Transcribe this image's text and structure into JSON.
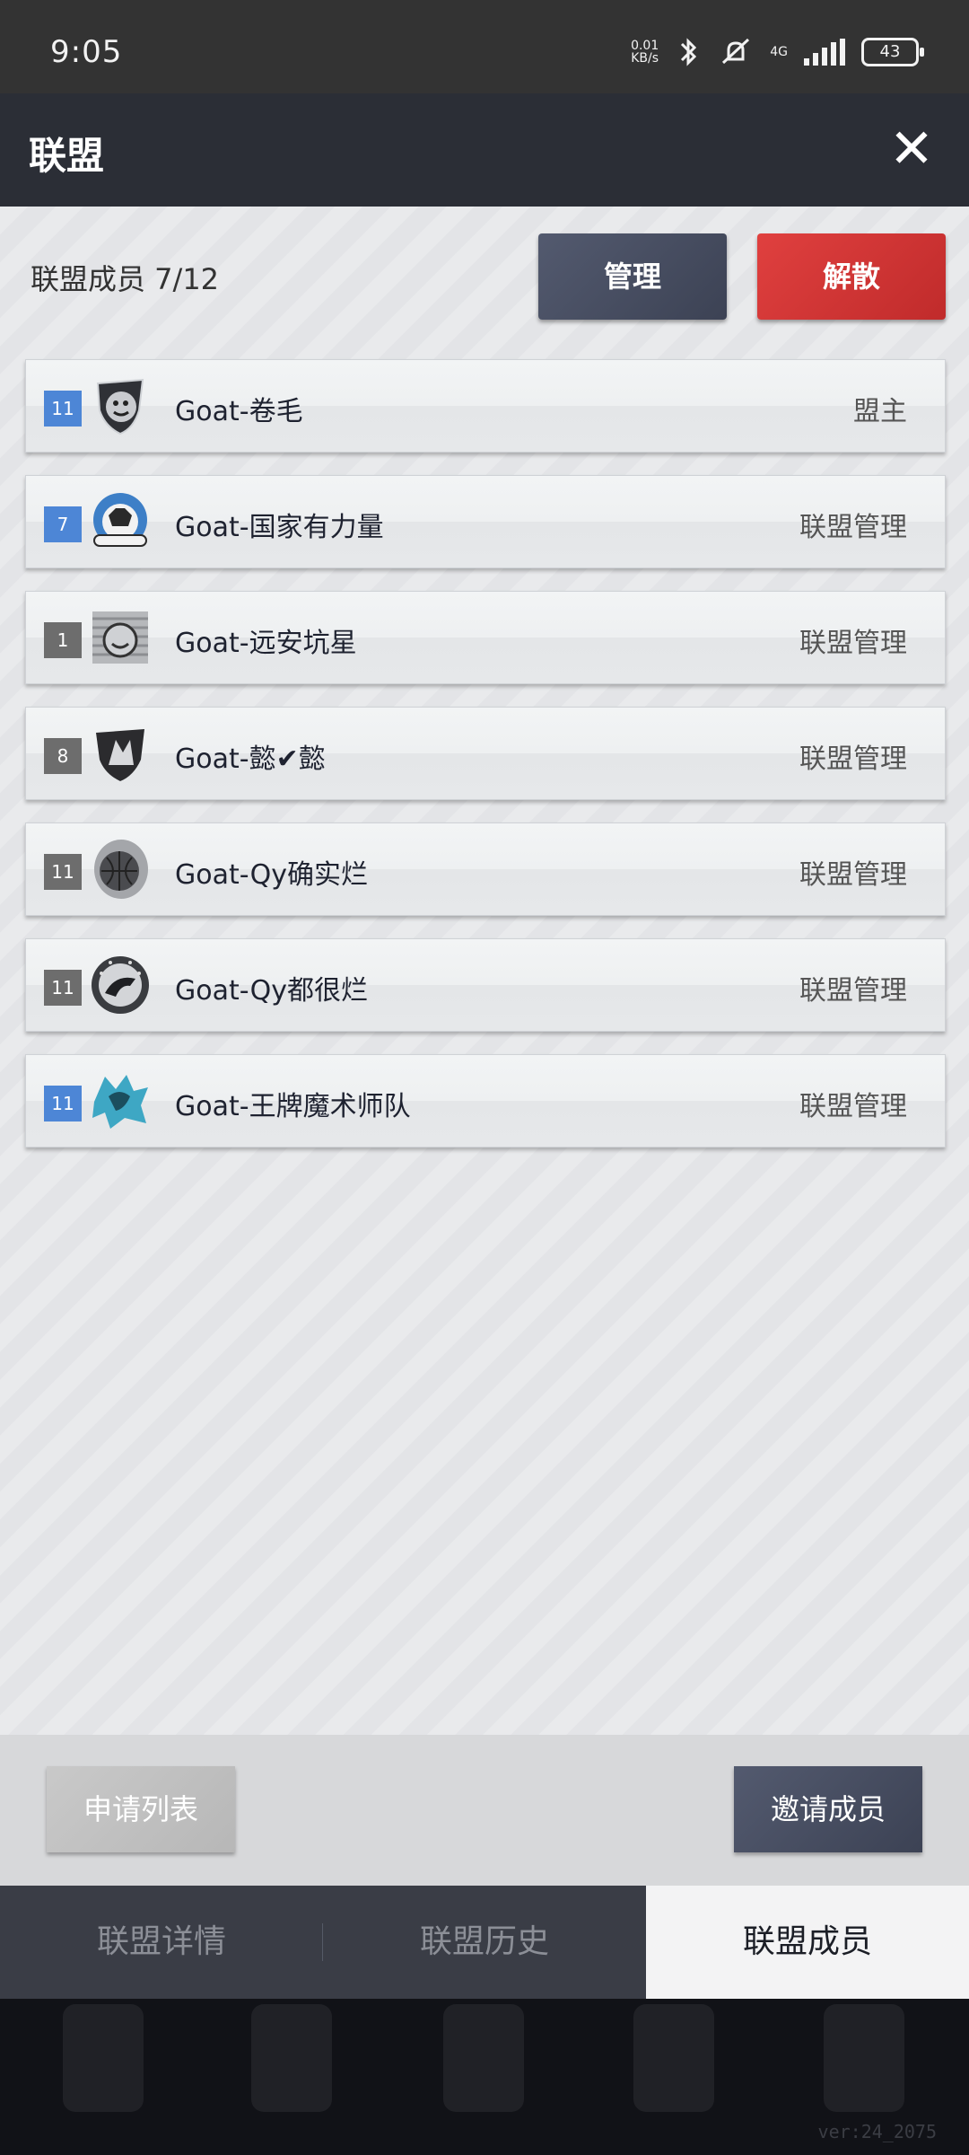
{
  "status_bar": {
    "time": "9:05",
    "net_speed": "0.01",
    "net_unit": "KB/s",
    "network": "4G",
    "battery": "43"
  },
  "header": {
    "title": "联盟",
    "close_icon": "close-icon"
  },
  "alliance": {
    "member_count_label": "联盟成员 7/12",
    "manage_label": "管理",
    "disband_label": "解散"
  },
  "members": [
    {
      "level": "11",
      "level_color": "#4d86d6",
      "name": "Goat-卷毛",
      "role": "盟主"
    },
    {
      "level": "7",
      "level_color": "#4d86d6",
      "name": "Goat-国家有力量",
      "role": "联盟管理"
    },
    {
      "level": "1",
      "level_color": "#6d6d6d",
      "name": "Goat-远安坑星",
      "role": "联盟管理"
    },
    {
      "level": "8",
      "level_color": "#6d6d6d",
      "name": "Goat-懿✔懿",
      "role": "联盟管理"
    },
    {
      "level": "11",
      "level_color": "#6d6d6d",
      "name": "Goat-Qy确实烂",
      "role": "联盟管理"
    },
    {
      "level": "11",
      "level_color": "#6d6d6d",
      "name": "Goat-Qy都很烂",
      "role": "联盟管理"
    },
    {
      "level": "11",
      "level_color": "#4d86d6",
      "name": "Goat-王牌魔术师队",
      "role": "联盟管理"
    }
  ],
  "actions": {
    "apply_list_label": "申请列表",
    "invite_label": "邀请成员"
  },
  "tabs": [
    {
      "label": "联盟详情",
      "active": false
    },
    {
      "label": "联盟历史",
      "active": false
    },
    {
      "label": "联盟成员",
      "active": true
    }
  ],
  "version": "ver:24_2075",
  "colors": {
    "accent_blue": "#4d86d6",
    "danger_red": "#d83a3a",
    "header_bg": "#2b2e36"
  }
}
